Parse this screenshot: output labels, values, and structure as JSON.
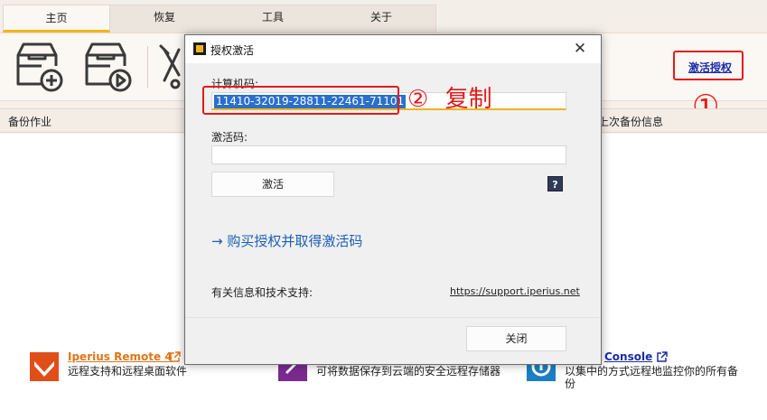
{
  "tabs": [
    "主页",
    "恢复",
    "工具",
    "关于"
  ],
  "ribbon": {
    "license_link": "激活授权",
    "icons": [
      "new-backup-icon",
      "run-backup-icon",
      "tools-icon"
    ]
  },
  "annotations": {
    "step1": "①",
    "step2": "②",
    "step2_text": "复制"
  },
  "table": {
    "col_jobs": "备份作业",
    "col_last": "上次备份信息"
  },
  "promos": [
    {
      "title": "Iperius Remote 4",
      "desc": "远程支持和远程桌面软件"
    },
    {
      "title": "",
      "desc": "可将数据保存到云端的安全远程存储器"
    },
    {
      "title": "Console",
      "desc": "以集中的方式远程地监控你的所有备份"
    }
  ],
  "dialog": {
    "title": "授权激活",
    "code_label": "计算机码:",
    "computer_code": "11410-32019-28811-22461-71101",
    "activation_label": "激活码:",
    "activation_value": "",
    "activate_button": "激活",
    "help_button": "?",
    "buy_link": "→ 购买授权并取得激活码",
    "support_label": "有关信息和技术支持:",
    "support_url": "https://support.iperius.net",
    "close_button": "关闭",
    "close_icon": "✕"
  },
  "colors": {
    "accent": "#f1b51c",
    "annotation_red": "#e41b1b",
    "link_blue": "#1a2ca8"
  }
}
